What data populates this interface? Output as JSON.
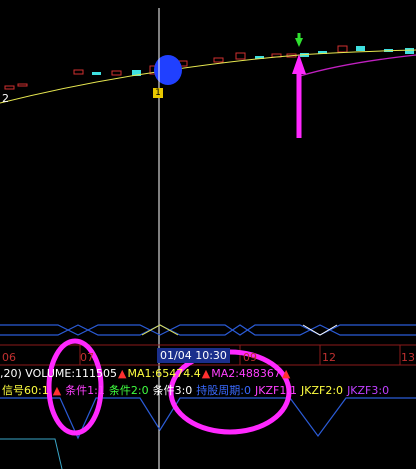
{
  "colors": {
    "background": "#000000",
    "grid": "#8b1a1a",
    "candle_up": "#d03030",
    "candle_down": "#3fe0e0",
    "ma1": "#e8e850",
    "ma2": "#c020c0",
    "crosshair": "#ffffff",
    "annotation": "#ff28ff",
    "signal_line": "#2b5bd6",
    "cyan_line": "#3aa6c8"
  },
  "left_value_label": "2",
  "event_marker": "1",
  "date_axis": {
    "ticks": [
      "06",
      "07",
      "09",
      "12",
      "13"
    ],
    "selected": "01/04 10:30"
  },
  "volume_row": {
    "items": [
      {
        "text": ",20) VOLUME:111505",
        "color": "#ffffff"
      },
      {
        "text": "▲",
        "color": "#ff3030"
      },
      {
        "text": "MA1:65474.4",
        "color": "#ffff40"
      },
      {
        "text": "▲",
        "color": "#ff3030"
      },
      {
        "text": "MA2:488367",
        "color": "#ff40ff"
      },
      {
        "text": "▲",
        "color": "#ff3030"
      }
    ]
  },
  "indicator_row": {
    "items": [
      {
        "text": "信号60:1",
        "color": "#ffff40"
      },
      {
        "text": "▲",
        "color": "#ff3030"
      },
      {
        "text": "条件1:1",
        "color": "#ff40ff"
      },
      {
        "text": "条件2:0",
        "color": "#40ff40"
      },
      {
        "text": "条件3:0",
        "color": "#ffffff"
      },
      {
        "text": "持股周期:0",
        "color": "#3a6aff"
      },
      {
        "text": "JKZF1:1",
        "color": "#ff40ff"
      },
      {
        "text": "JKZF2:0",
        "color": "#ffff40"
      },
      {
        "text": "JKZF3:0",
        "color": "#c040ff"
      }
    ]
  }
}
